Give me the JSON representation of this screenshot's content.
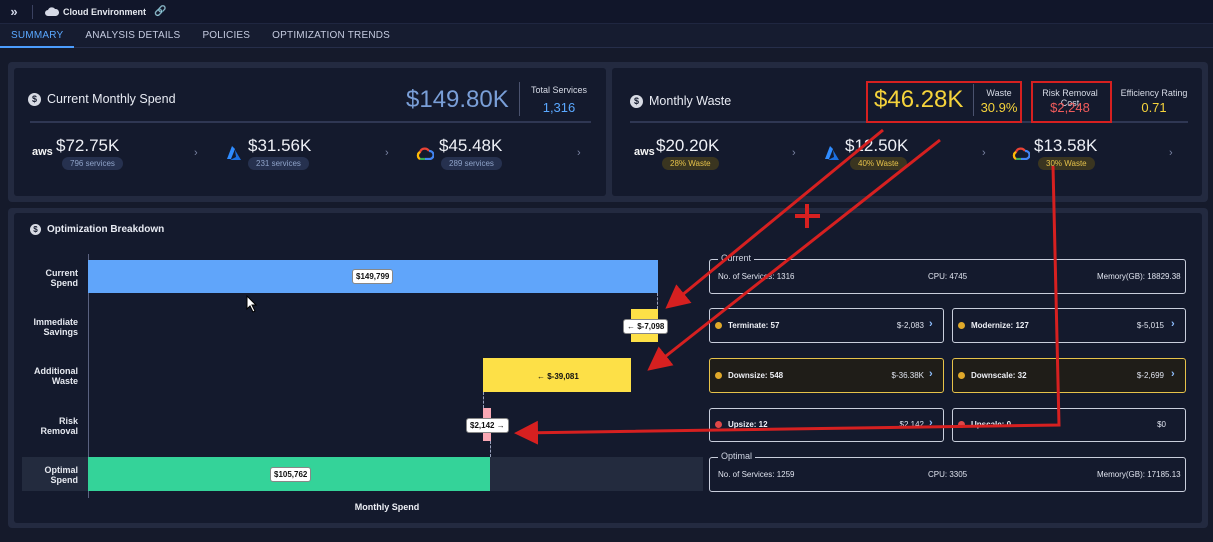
{
  "topbar": {
    "title": "Cloud Environment"
  },
  "tabs": [
    "SUMMARY",
    "ANALYSIS DETAILS",
    "POLICIES",
    "OPTIMIZATION TRENDS"
  ],
  "spend": {
    "title": "Current Monthly Spend",
    "total": "$149.80K",
    "services_label": "Total Services",
    "services_value": "1,316",
    "providers": [
      {
        "logo": "aws",
        "amount": "$72.75K",
        "sub": "796 services"
      },
      {
        "logo": "azure",
        "amount": "$31.56K",
        "sub": "231 services"
      },
      {
        "logo": "gcp",
        "amount": "$45.48K",
        "sub": "289 services"
      }
    ]
  },
  "waste": {
    "title": "Monthly Waste",
    "total": "$46.28K",
    "waste_label": "Waste",
    "waste_pct": "30.9%",
    "risk_label": "Risk Removal Cost",
    "risk_value": "$2,248",
    "eff_label": "Efficiency Rating",
    "eff_value": "0.71",
    "providers": [
      {
        "logo": "aws",
        "amount": "$20.20K",
        "sub": "28% Waste"
      },
      {
        "logo": "azure",
        "amount": "$12.50K",
        "sub": "40% Waste"
      },
      {
        "logo": "gcp",
        "amount": "$13.58K",
        "sub": "30% Waste"
      }
    ]
  },
  "breakdown": {
    "title": "Optimization Breakdown",
    "x_label": "Monthly Spend",
    "rows": {
      "current": {
        "l1": "Current",
        "l2": "Spend",
        "tag": "$149,799"
      },
      "immediate": {
        "l1": "Immediate",
        "l2": "Savings",
        "tag": "← $-7,098"
      },
      "additional": {
        "l1": "Additional",
        "l2": "Waste",
        "tag": "← $-39,081"
      },
      "risk": {
        "l1": "Risk",
        "l2": "Removal",
        "tag": "$2,142 →"
      },
      "optimal": {
        "l1": "Optimal",
        "l2": "Spend",
        "tag": "$105,762"
      }
    },
    "current_box": {
      "legend": "Current",
      "services": "No. of Services: 1316",
      "cpu": "CPU: 4745",
      "memory": "Memory(GB): 18829.38"
    },
    "optimal_box": {
      "legend": "Optimal",
      "services": "No. of Services: 1259",
      "cpu": "CPU: 3305",
      "memory": "Memory(GB): 17185.13"
    },
    "actions": {
      "terminate": {
        "label": "Terminate: 57",
        "value": "$-2,083"
      },
      "modernize": {
        "label": "Modernize: 127",
        "value": "$-5,015"
      },
      "downsize": {
        "label": "Downsize: 548",
        "value": "$-36.38K"
      },
      "downscale": {
        "label": "Downscale: 32",
        "value": "$-2,699"
      },
      "upsize": {
        "label": "Upsize: 12",
        "value": "$2,142"
      },
      "upscale": {
        "label": "Upscale: 0",
        "value": "$0"
      }
    }
  },
  "colors": {
    "accent": "#4b9dff",
    "current_bar": "#60a5fa",
    "savings_bar": "#fde047",
    "risk_bar": "#f9a8b4",
    "optimal_bar": "#34d399",
    "annotation": "#d62020"
  }
}
